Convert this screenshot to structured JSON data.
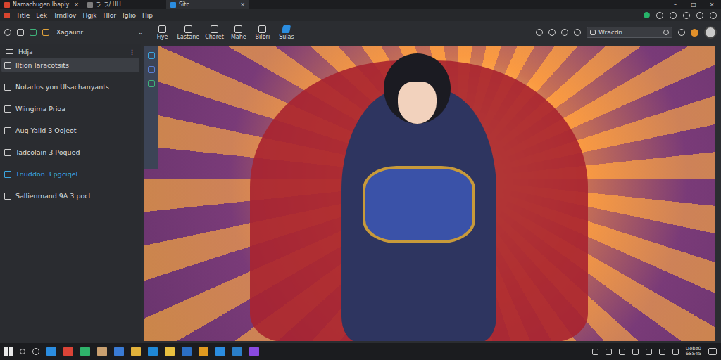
{
  "window": {
    "tabs": [
      {
        "label": "Namachugen Ibapiy",
        "close": "×",
        "selected": false
      },
      {
        "label": "ラ ラ/ HH",
        "close": "",
        "selected": false
      },
      {
        "label": "Sitc",
        "close": "×",
        "selected": true
      }
    ],
    "controls": [
      "–",
      "□",
      "×"
    ]
  },
  "menu": [
    "Title",
    "Lek",
    "Trndlov",
    "Hgjk",
    "Hlor",
    "Iglio",
    "Hip"
  ],
  "toolbar": {
    "label": "Xagaunr",
    "dropdown": "⌄",
    "buttons": [
      {
        "label": "Fiye",
        "kind": "plain"
      },
      {
        "label": "Lastane",
        "kind": "plain"
      },
      {
        "label": "Charet",
        "kind": "plain"
      },
      {
        "label": "Mahe",
        "kind": "plain"
      },
      {
        "label": "Bilbri",
        "kind": "plain"
      },
      {
        "label": "Sulas",
        "kind": "blue"
      }
    ],
    "search": {
      "value": "Wracdn"
    }
  },
  "sidebar": {
    "title": "Hdja",
    "more": "⋮",
    "items": [
      {
        "label": "Iltion Iaracotsits",
        "selected": true,
        "highlight": false
      },
      {
        "label": "Notarlos yon Ulsachanyants",
        "selected": false,
        "highlight": false
      },
      {
        "label": "Wiingima Prioa",
        "selected": false,
        "highlight": false
      },
      {
        "label": "Aug Yalld 3 Oojeot",
        "selected": false,
        "highlight": false
      },
      {
        "label": "Tadcolain 3 Poqued",
        "selected": false,
        "highlight": false
      },
      {
        "label": "Tnuddon 3 pgciqel",
        "selected": false,
        "highlight": true
      },
      {
        "label": "Sallienmand 9A 3 pocl",
        "selected": false,
        "highlight": false
      }
    ]
  },
  "taskbar": {
    "clock": [
      "Uebz0",
      "6SS45"
    ]
  }
}
